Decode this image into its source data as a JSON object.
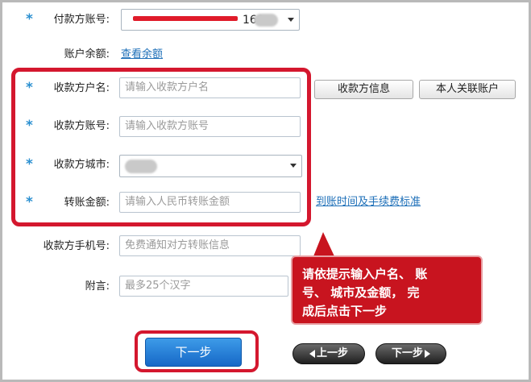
{
  "form": {
    "payer_account": {
      "star": "*",
      "label": "付款方账号:",
      "value_suffix": "169"
    },
    "balance": {
      "label": "账户余额:",
      "link": "查看余额"
    },
    "payee_name": {
      "star": "*",
      "label": "收款方户名:",
      "placeholder": "请输入收款方户名"
    },
    "payee_account": {
      "star": "*",
      "label": "收款方账号:",
      "placeholder": "请输入收款方账号"
    },
    "payee_city": {
      "star": "*",
      "label": "收款方城市:"
    },
    "amount": {
      "star": "*",
      "label": "转账金额:",
      "placeholder": "请输入人民币转账金额",
      "link": "到账时间及手续费标准"
    },
    "payee_phone": {
      "label": "收款方手机号:",
      "placeholder": "免费通知对方转账信息"
    },
    "memo": {
      "label": "附言:",
      "placeholder": "最多25个汉字"
    }
  },
  "buttons": {
    "payee_info": "收款方信息",
    "linked_accounts": "本人关联账户",
    "next_main": "下一步",
    "prev": "上一步",
    "next": "下一步"
  },
  "callout": {
    "line1": "请依提示输入户名、 账",
    "line2": "号、 城市及金额， 完",
    "line3": "成后点击下一步"
  },
  "colors": {
    "highlight_red": "#d4172e",
    "link_blue": "#1d6fb8",
    "star_blue": "#2a8fd0",
    "callout_red": "#c8141f",
    "primary_button_blue": "#1f78d1"
  },
  "icons": {
    "required_marker": "asterisk",
    "dropdown": "chevron-down-icon",
    "prev_arrow": "arrow-left-icon",
    "next_arrow": "arrow-right-icon"
  }
}
